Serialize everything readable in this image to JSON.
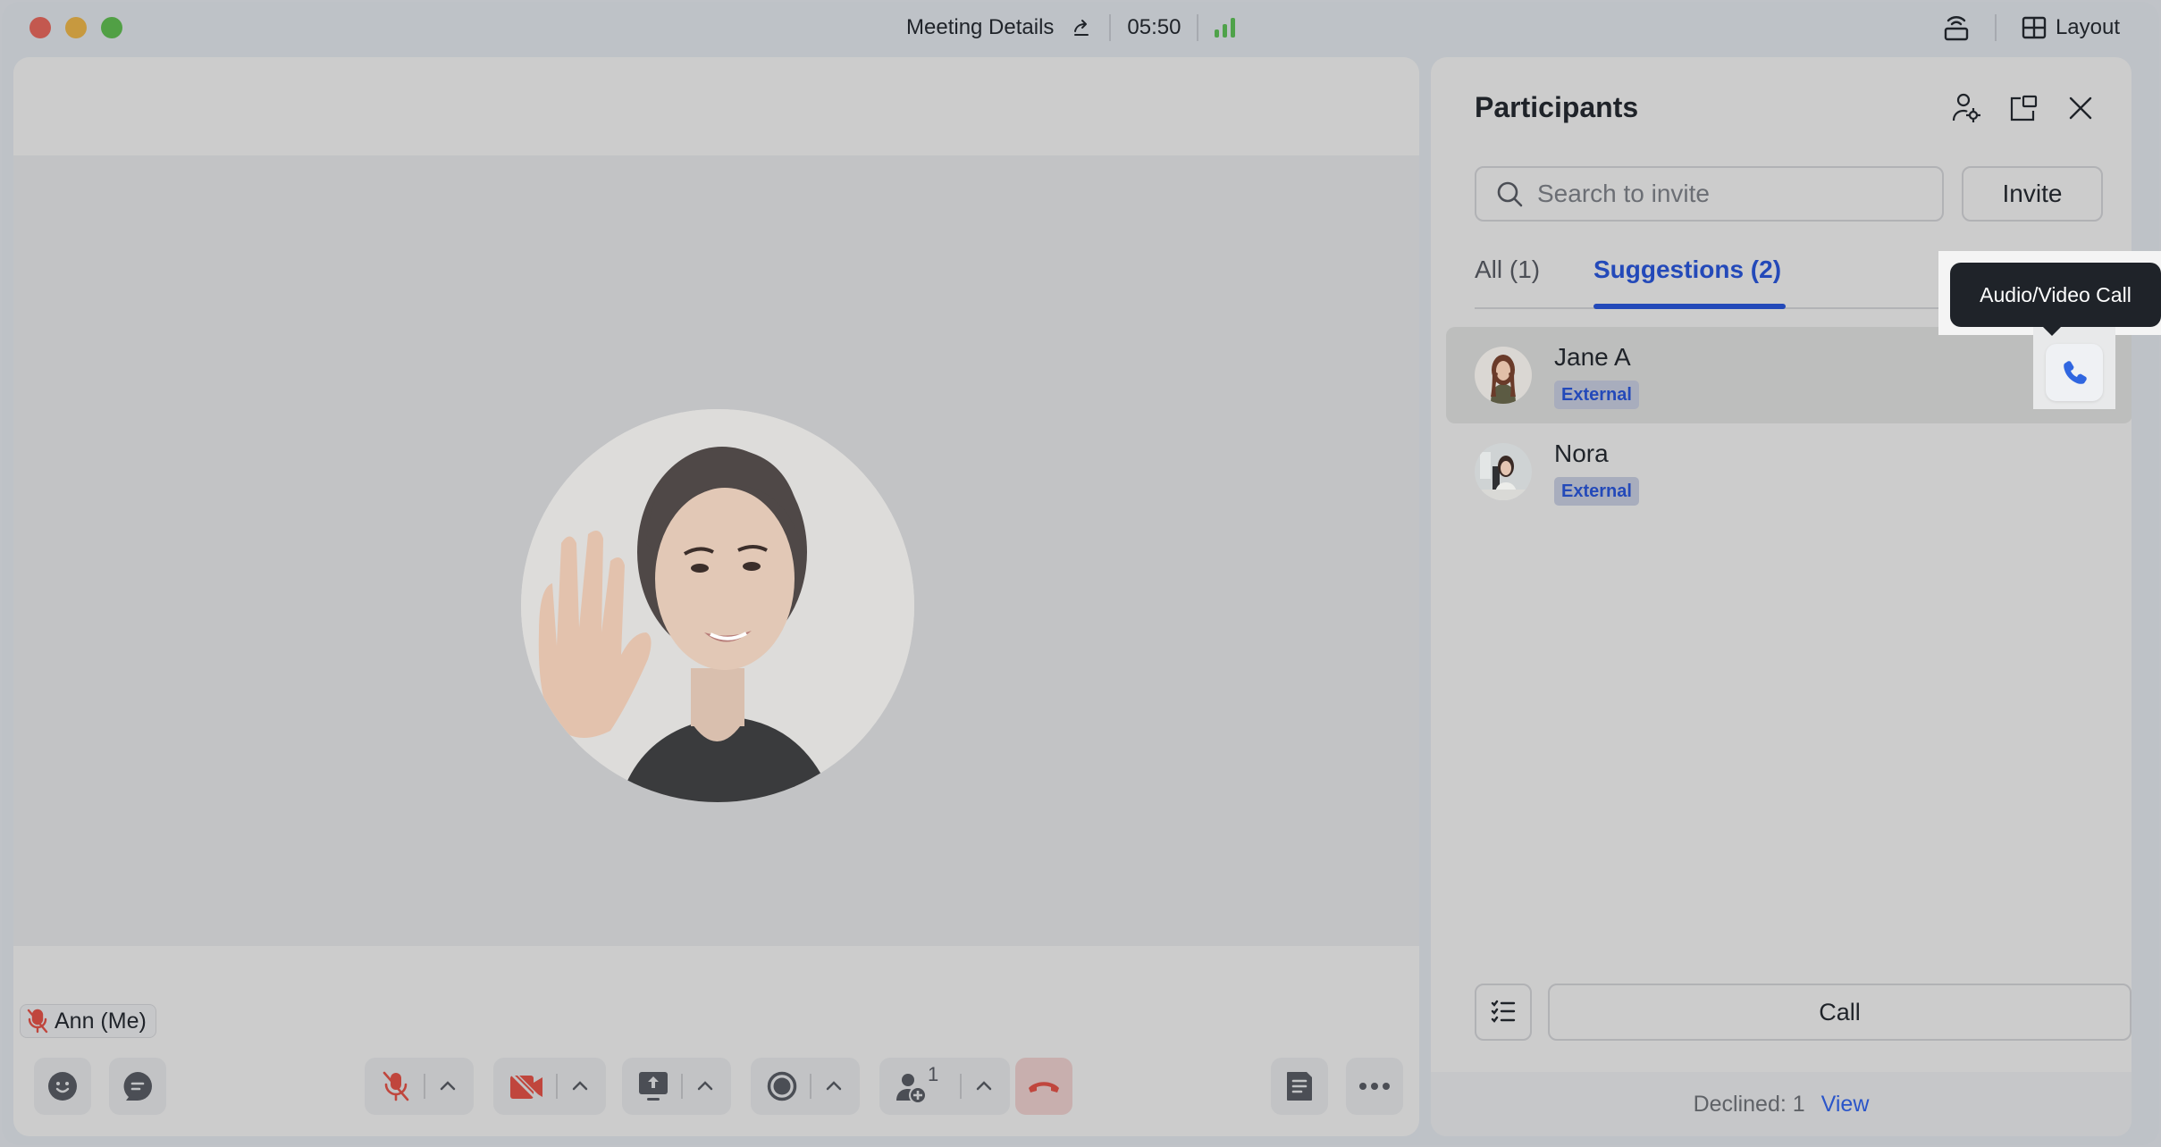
{
  "window": {
    "title": "Meeting Details",
    "timer": "05:50",
    "signal_color": "#4fa24a",
    "layout_label": "Layout",
    "traffic_lights": [
      "close",
      "minimize",
      "maximize"
    ]
  },
  "stage": {
    "self_name": "Ann (Me)",
    "self_muted": true,
    "toolbar": {
      "left": [
        {
          "name": "reactions",
          "icon": "smile-icon"
        },
        {
          "name": "chat",
          "icon": "chat-bubble-icon"
        }
      ],
      "center": [
        {
          "name": "microphone",
          "icon": "mic-off-icon",
          "state": "muted"
        },
        {
          "name": "camera",
          "icon": "camera-off-icon",
          "state": "off"
        },
        {
          "name": "share-screen",
          "icon": "share-screen-icon"
        },
        {
          "name": "record",
          "icon": "record-icon"
        },
        {
          "name": "participants",
          "icon": "add-person-icon",
          "count": "1"
        },
        {
          "name": "leave",
          "icon": "hang-up-icon"
        }
      ],
      "right": [
        {
          "name": "notes",
          "icon": "document-icon"
        },
        {
          "name": "more",
          "icon": "more-icon"
        }
      ]
    }
  },
  "participants_panel": {
    "title": "Participants",
    "header_icons": [
      "manage-participants-icon",
      "pop-out-icon",
      "close-icon"
    ],
    "search_placeholder": "Search to invite",
    "search_value": "",
    "invite_label": "Invite",
    "tabs": [
      {
        "label": "All (1)",
        "active": false
      },
      {
        "label": "Suggestions (2)",
        "active": true
      }
    ],
    "suggestions": [
      {
        "name": "Jane A",
        "tag": "External",
        "hovered": true
      },
      {
        "name": "Nora",
        "tag": "External",
        "hovered": false
      }
    ],
    "tooltip": "Audio/Video Call",
    "call_label": "Call",
    "declined_text": "Declined: 1",
    "view_label": "View",
    "accent_color": "#2349b9"
  }
}
